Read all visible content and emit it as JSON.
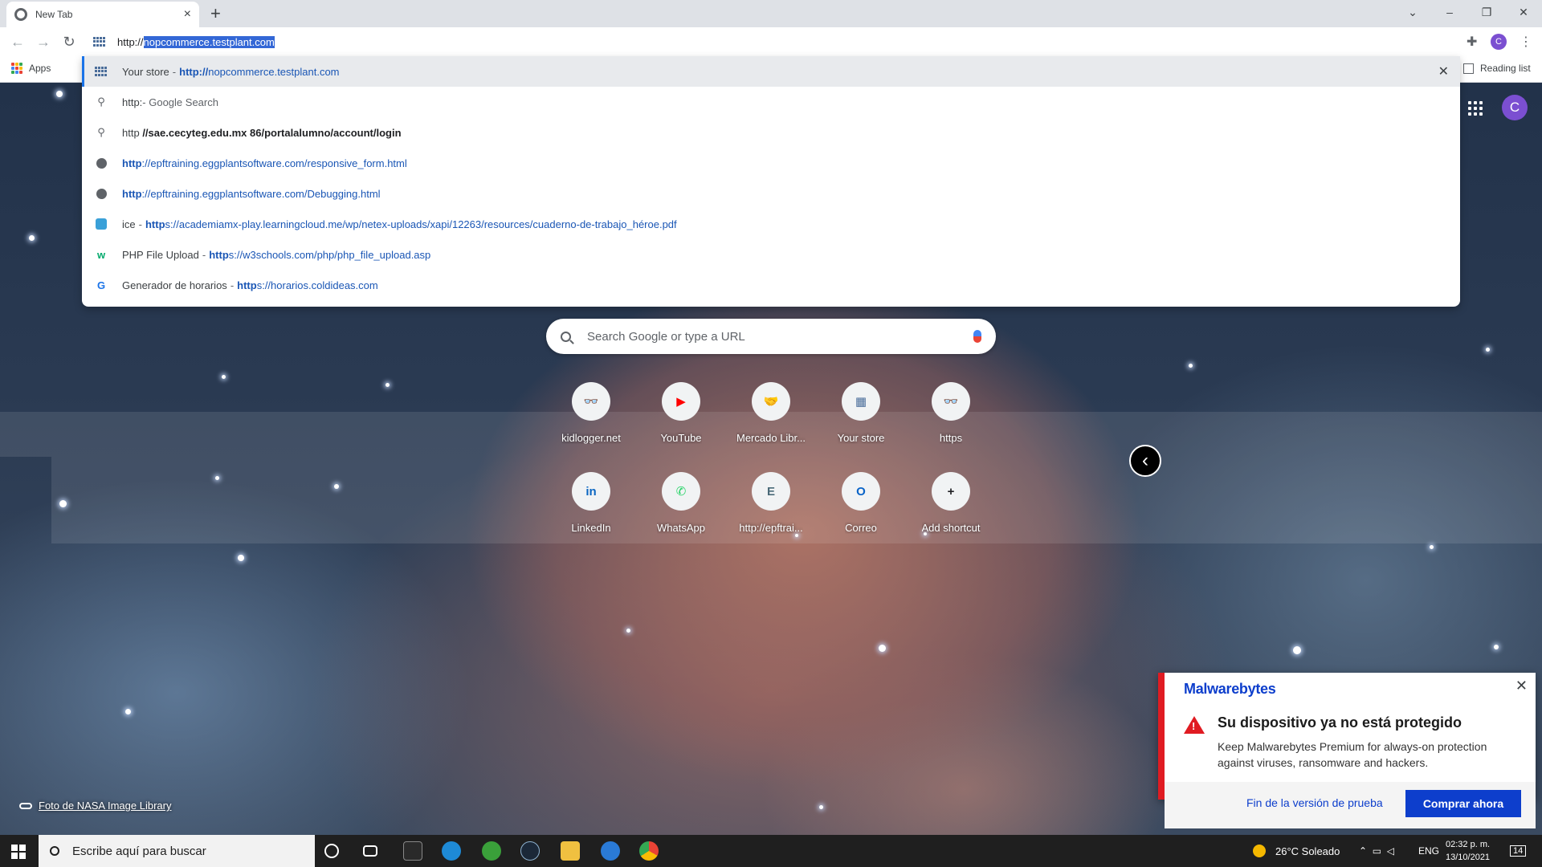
{
  "browser": {
    "tab_title": "New Tab",
    "tab_close": "×",
    "new_tab": "+",
    "window_controls": {
      "dropdown": "⌄",
      "minimize": "–",
      "restore": "❐",
      "close": "✕"
    },
    "url_prefix": "http://",
    "url_selected": "nopcommerce.testplant.com",
    "bookmarks_apps": "Apps",
    "reading_list": "Reading list",
    "profile_initial": "C",
    "apps_colors": [
      "#ea4335",
      "#fbbc04",
      "#34a853",
      "#4285f4",
      "#ea4335",
      "#fbbc04",
      "#34a853",
      "#4285f4",
      "#ea4335"
    ]
  },
  "suggestions": [
    {
      "icon": "site-grid-icon",
      "title": "Your store",
      "url_bold": "http://",
      "url_rest": "nopcommerce.testplant.com",
      "active": true,
      "remove": "✕"
    },
    {
      "icon": "search-icon",
      "text": "http:",
      "suffix": " - Google Search"
    },
    {
      "icon": "search-icon",
      "text": "http ",
      "bold": "//sae.cecyteg.edu.mx 86/portalalumno/account/login"
    },
    {
      "icon": "globe-icon",
      "url_bold": "http",
      "url_rest": "://epftraining.eggplantsoftware.com/responsive_form.html"
    },
    {
      "icon": "globe-icon",
      "url_bold": "http",
      "url_rest": "://epftraining.eggplantsoftware.com/Debugging.html"
    },
    {
      "icon": "learningcloud-icon",
      "title": "ice",
      "url_bold": "http",
      "url_rest": "s://academiamx-play.learningcloud.me/wp/netex-uploads/xapi/12263/resources/cuaderno-de-trabajo_héroe.pdf"
    },
    {
      "icon": "w3schools-icon",
      "title": "PHP File Upload",
      "url_bold": "http",
      "url_rest": "s://w3schools.com/php/php_file_upload.asp"
    },
    {
      "icon": "coldideas-icon",
      "title": "Generador de horarios",
      "url_bold": "http",
      "url_rest": "s://horarios.coldideas.com"
    }
  ],
  "ntp": {
    "search_placeholder": "Search Google or type a URL",
    "profile_initial": "C",
    "shortcuts": [
      {
        "label": "kidlogger.net",
        "glyph": "👓",
        "color": "#1a56b5"
      },
      {
        "label": "YouTube",
        "glyph": "▶",
        "color": "#ff0000"
      },
      {
        "label": "Mercado Libr...",
        "glyph": "🤝",
        "color": "#e5b800"
      },
      {
        "label": "Your store",
        "glyph": "▦",
        "color": "#4a6d9a"
      },
      {
        "label": "https",
        "glyph": "👓",
        "color": "#1a56b5"
      },
      {
        "label": "LinkedIn",
        "glyph": "in",
        "color": "#0a66c2"
      },
      {
        "label": "WhatsApp",
        "glyph": "✆",
        "color": "#25d366"
      },
      {
        "label": "http://epftrai...",
        "glyph": "E",
        "color": "#4a6a78"
      },
      {
        "label": "Correo",
        "glyph": "O",
        "color": "#0a64c8"
      },
      {
        "label": "Add shortcut",
        "glyph": "+",
        "color": "#202124"
      }
    ],
    "carousel_arrow": "‹",
    "photo_credit": "Foto de NASA Image Library"
  },
  "malwarebytes": {
    "brand": "Malwarebytes",
    "close": "✕",
    "title": "Su dispositivo ya no está protegido",
    "body": "Keep Malwarebytes Premium for always-on protection against viruses, ransomware and hackers.",
    "trial": "Fin de la versión de prueba",
    "buy": "Comprar ahora"
  },
  "taskbar": {
    "search_placeholder": "Escribe aquí para buscar",
    "weather": "26°C  Soleado",
    "lang": "ENG",
    "time": "02:32 p. m.",
    "date": "13/10/2021",
    "notifications": "14"
  }
}
